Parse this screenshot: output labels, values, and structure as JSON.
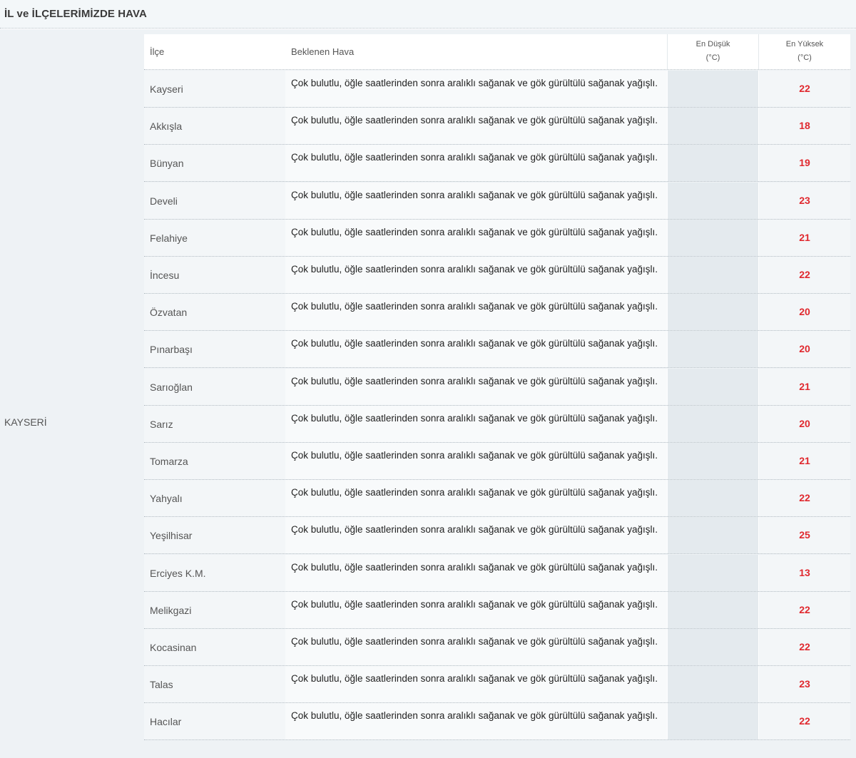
{
  "title": "İL ve İLÇELERİMİZDE HAVA",
  "province": "KAYSERİ",
  "table": {
    "headers": {
      "ilce": "İlçe",
      "hava": "Beklenen Hava",
      "low_line1": "En Düşük",
      "low_line2": "(°C)",
      "high_line1": "En Yüksek",
      "high_line2": "(°C)"
    },
    "rows": [
      {
        "ilce": "Kayseri",
        "hava": "Çok bulutlu, öğle saatlerinden sonra aralıklı sağanak ve gök gürültülü sağanak yağışlı.",
        "low": "",
        "high": "22"
      },
      {
        "ilce": "Akkışla",
        "hava": "Çok bulutlu, öğle saatlerinden sonra aralıklı sağanak ve gök gürültülü sağanak yağışlı.",
        "low": "",
        "high": "18"
      },
      {
        "ilce": "Bünyan",
        "hava": "Çok bulutlu, öğle saatlerinden sonra aralıklı sağanak ve gök gürültülü sağanak yağışlı.",
        "low": "",
        "high": "19"
      },
      {
        "ilce": "Develi",
        "hava": "Çok bulutlu, öğle saatlerinden sonra aralıklı sağanak ve gök gürültülü sağanak yağışlı.",
        "low": "",
        "high": "23"
      },
      {
        "ilce": "Felahiye",
        "hava": "Çok bulutlu, öğle saatlerinden sonra aralıklı sağanak ve gök gürültülü sağanak yağışlı.",
        "low": "",
        "high": "21"
      },
      {
        "ilce": "İncesu",
        "hava": "Çok bulutlu, öğle saatlerinden sonra aralıklı sağanak ve gök gürültülü sağanak yağışlı.",
        "low": "",
        "high": "22"
      },
      {
        "ilce": "Özvatan",
        "hava": "Çok bulutlu, öğle saatlerinden sonra aralıklı sağanak ve gök gürültülü sağanak yağışlı.",
        "low": "",
        "high": "20"
      },
      {
        "ilce": "Pınarbaşı",
        "hava": "Çok bulutlu, öğle saatlerinden sonra aralıklı sağanak ve gök gürültülü sağanak yağışlı.",
        "low": "",
        "high": "20"
      },
      {
        "ilce": "Sarıoğlan",
        "hava": "Çok bulutlu, öğle saatlerinden sonra aralıklı sağanak ve gök gürültülü sağanak yağışlı.",
        "low": "",
        "high": "21"
      },
      {
        "ilce": "Sarız",
        "hava": "Çok bulutlu, öğle saatlerinden sonra aralıklı sağanak ve gök gürültülü sağanak yağışlı.",
        "low": "",
        "high": "20"
      },
      {
        "ilce": "Tomarza",
        "hava": "Çok bulutlu, öğle saatlerinden sonra aralıklı sağanak ve gök gürültülü sağanak yağışlı.",
        "low": "",
        "high": "21"
      },
      {
        "ilce": "Yahyalı",
        "hava": "Çok bulutlu, öğle saatlerinden sonra aralıklı sağanak ve gök gürültülü sağanak yağışlı.",
        "low": "",
        "high": "22"
      },
      {
        "ilce": "Yeşilhisar",
        "hava": "Çok bulutlu, öğle saatlerinden sonra aralıklı sağanak ve gök gürültülü sağanak yağışlı.",
        "low": "",
        "high": "25"
      },
      {
        "ilce": "Erciyes K.M.",
        "hava": "Çok bulutlu, öğle saatlerinden sonra aralıklı sağanak ve gök gürültülü sağanak yağışlı.",
        "low": "",
        "high": "13"
      },
      {
        "ilce": "Melikgazi",
        "hava": "Çok bulutlu, öğle saatlerinden sonra aralıklı sağanak ve gök gürültülü sağanak yağışlı.",
        "low": "",
        "high": "22"
      },
      {
        "ilce": "Kocasinan",
        "hava": "Çok bulutlu, öğle saatlerinden sonra aralıklı sağanak ve gök gürültülü sağanak yağışlı.",
        "low": "",
        "high": "22"
      },
      {
        "ilce": "Talas",
        "hava": "Çok bulutlu, öğle saatlerinden sonra aralıklı sağanak ve gök gürültülü sağanak yağışlı.",
        "low": "",
        "high": "23"
      },
      {
        "ilce": "Hacılar",
        "hava": "Çok bulutlu, öğle saatlerinden sonra aralıklı sağanak ve gök gürültülü sağanak yağışlı.",
        "low": "",
        "high": "22"
      }
    ]
  },
  "colors": {
    "high_temp": "#e0282e"
  }
}
